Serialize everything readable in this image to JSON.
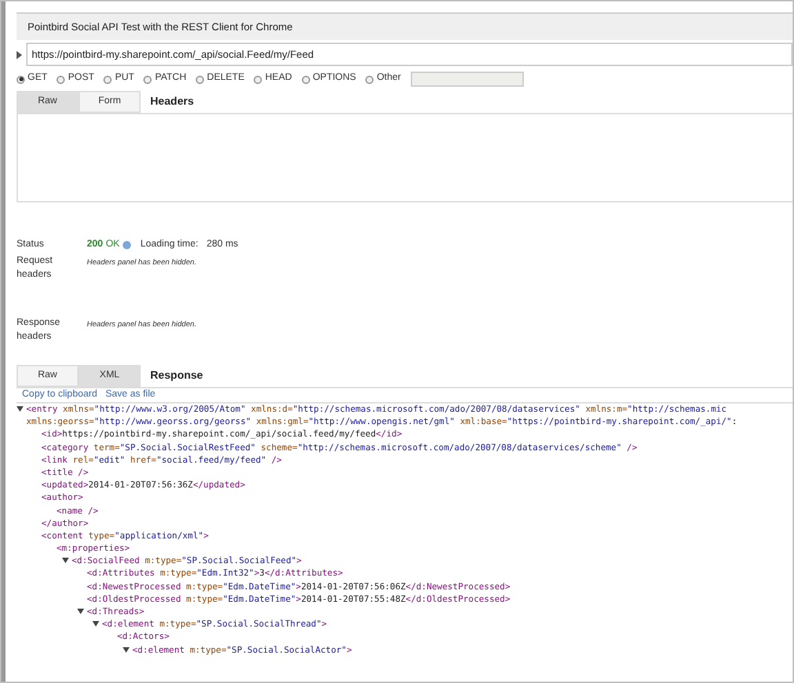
{
  "title": "Pointbird Social API Test with the REST Client for Chrome",
  "url": {
    "value": "https://pointbird-my.sharepoint.com/_api/social.Feed/my/Feed",
    "expanded": false
  },
  "methods": [
    {
      "label": "GET",
      "selected": true
    },
    {
      "label": "POST",
      "selected": false
    },
    {
      "label": "PUT",
      "selected": false
    },
    {
      "label": "PATCH",
      "selected": false
    },
    {
      "label": "DELETE",
      "selected": false
    },
    {
      "label": "HEAD",
      "selected": false
    },
    {
      "label": "OPTIONS",
      "selected": false
    },
    {
      "label": "Other",
      "selected": false
    }
  ],
  "request_tabs": [
    {
      "label": "Raw",
      "selected": true
    },
    {
      "label": "Form",
      "selected": false
    }
  ],
  "request_heading": "Headers",
  "status": {
    "label": "Status",
    "code": "200",
    "text": "OK",
    "loading_label": "Loading time:",
    "loading_value": "280 ms"
  },
  "request_headers": {
    "label": "Request headers",
    "note": "Headers panel has been hidden."
  },
  "response_headers": {
    "label": "Response headers",
    "note": "Headers panel has been hidden."
  },
  "response_tabs": [
    {
      "label": "Raw",
      "selected": false
    },
    {
      "label": "XML",
      "selected": true
    }
  ],
  "response_heading": "Response",
  "actions": [
    "Copy to clipboard",
    "Save as file"
  ],
  "xml": [
    {
      "open": "<entry xmlns=\"http://www.w3.org/2005/Atom\" xmlns:d=\"http://schemas.microsoft.com/ado/2007/08/dataservices\" xmlns:m=\"http://schemas.mic",
      "open_continued": "xmlns:georss=\"http://www.georss.org/georss\" xmlns:gml=\"http://www.opengis.net/gml\" xml:base=\"https://pointbird-my.sharepoint.com/_api/\":",
      "expanded": true,
      "children": [
        {
          "open": "<id>https://pointbird-my.sharepoint.com/_api/social.feed/my/feed</id>",
          "expanded": false
        },
        {
          "open": "<category term=\"SP.Social.SocialRestFeed\" scheme=\"http://schemas.microsoft.com/ado/2007/08/dataservices/scheme\" />",
          "expanded": false
        },
        {
          "open": "<link rel=\"edit\" href=\"social.feed/my/feed\" />",
          "expanded": false
        },
        {
          "open": "<title />",
          "expanded": false
        },
        {
          "open": "<updated>2014-01-20T07:56:36Z</updated>",
          "expanded": false
        },
        {
          "open": "<author>",
          "close": "</author>",
          "expanded": false,
          "children": [
            {
              "open": "<name />",
              "expanded": false
            }
          ]
        },
        {
          "open": "<content type=\"application/xml\">",
          "expanded": false,
          "children": [
            {
              "open": "<m:properties>",
              "expanded": false,
              "children": [
                {
                  "open": "<d:SocialFeed m:type=\"SP.Social.SocialFeed\">",
                  "expanded": true,
                  "children": [
                    {
                      "open": "<d:Attributes m:type=\"Edm.Int32\">3</d:Attributes>",
                      "expanded": false
                    },
                    {
                      "open": "<d:NewestProcessed m:type=\"Edm.DateTime\">2014-01-20T07:56:06Z</d:NewestProcessed>",
                      "expanded": false
                    },
                    {
                      "open": "<d:OldestProcessed m:type=\"Edm.DateTime\">2014-01-20T07:55:48Z</d:OldestProcessed>",
                      "expanded": false
                    },
                    {
                      "open": "<d:Threads>",
                      "expanded": true,
                      "children": [
                        {
                          "open": "<d:element m:type=\"SP.Social.SocialThread\">",
                          "expanded": true,
                          "children": [
                            {
                              "open": "<d:Actors>",
                              "expanded": false,
                              "children": [
                                {
                                  "open": "<d:element m:type=\"SP.Social.SocialActor\">",
                                  "expanded": true
                                }
                              ]
                            }
                          ]
                        }
                      ]
                    }
                  ]
                }
              ]
            }
          ]
        }
      ]
    }
  ]
}
